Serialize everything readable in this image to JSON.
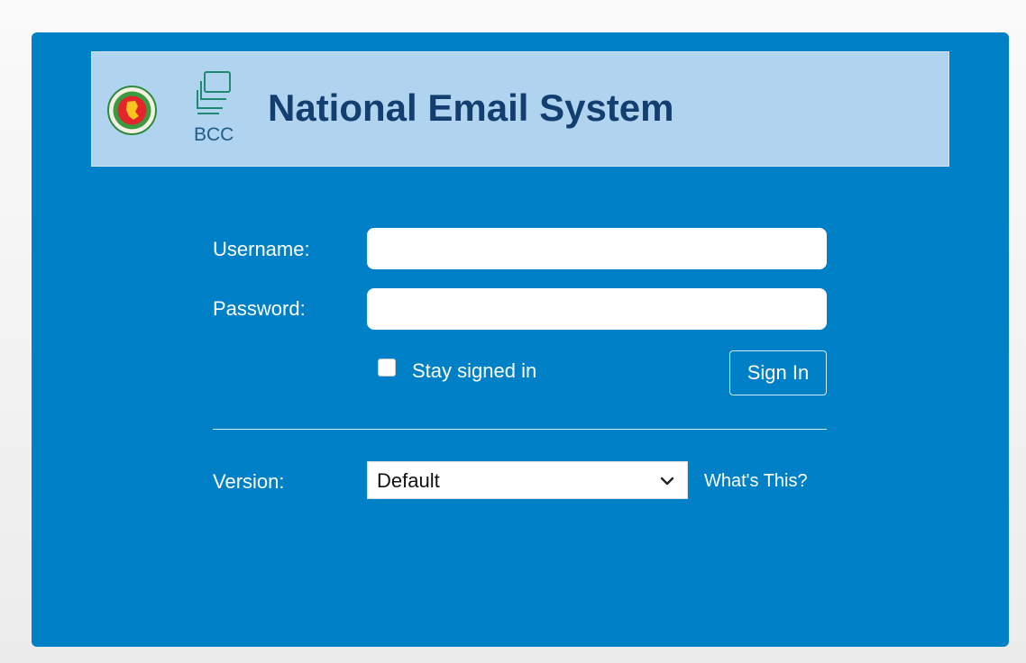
{
  "banner": {
    "title": "National Email System",
    "bcc_label": "BCC"
  },
  "form": {
    "username_label": "Username:",
    "username_value": "",
    "password_label": "Password:",
    "password_value": "",
    "stay_signed_in_label": "Stay signed in",
    "stay_signed_in_checked": false,
    "sign_in_label": "Sign In",
    "version_label": "Version:",
    "version_selected": "Default",
    "whats_this_label": "What's This?"
  },
  "colors": {
    "panel": "#0080c6",
    "banner": "#b0d4ef",
    "title": "#123e70"
  },
  "icons": {
    "seal": "government-seal-icon",
    "bcc": "bcc-monitor-logo",
    "chevron": "chevron-down-icon"
  }
}
